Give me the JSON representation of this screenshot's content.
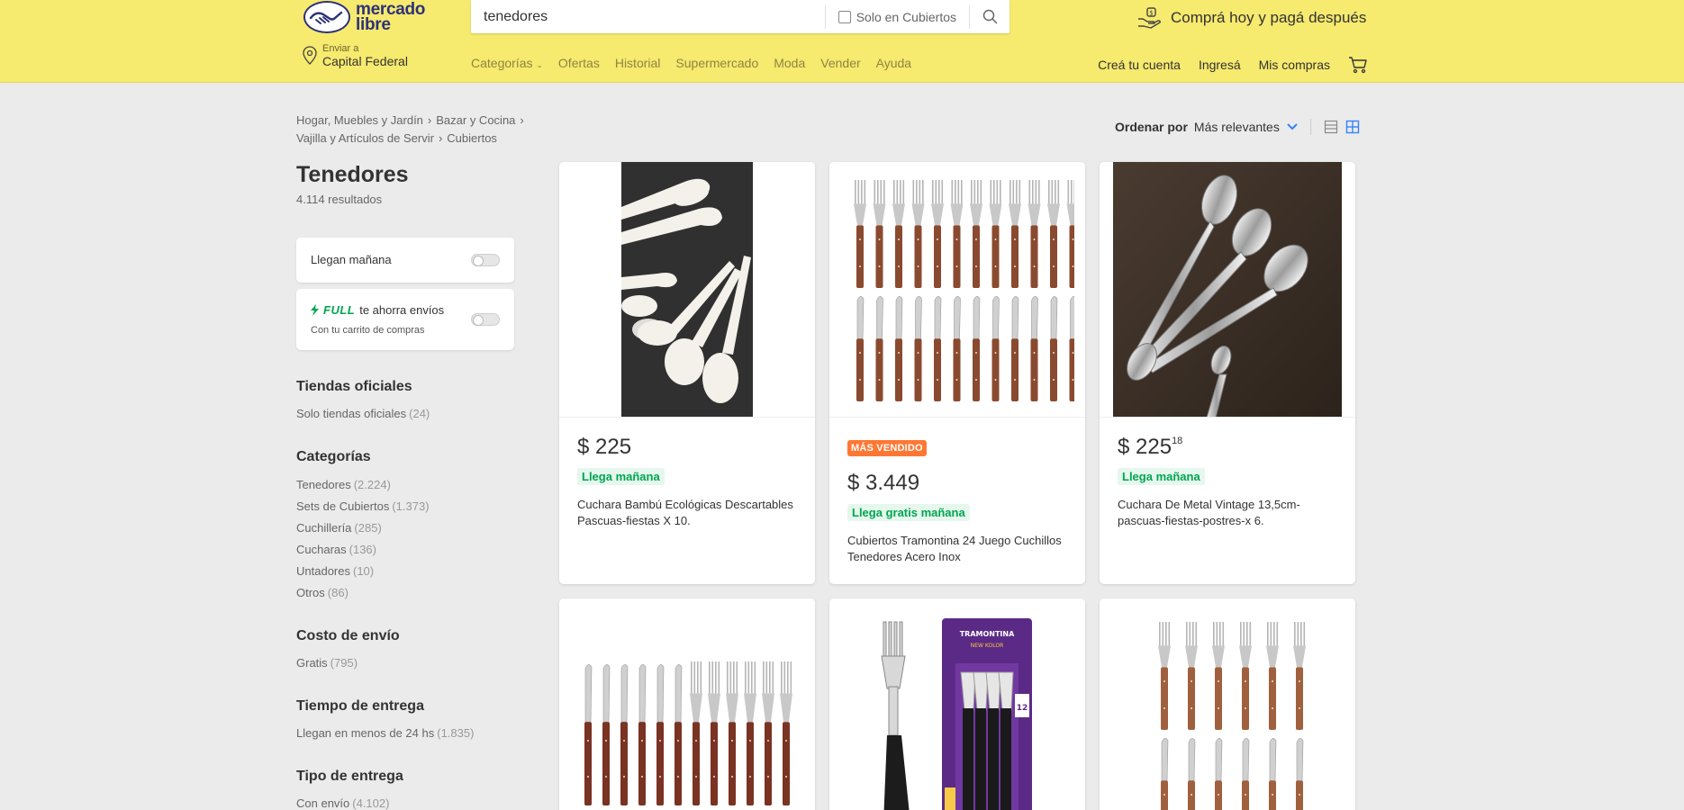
{
  "header": {
    "logo_line1": "mercado",
    "logo_line2": "libre",
    "search_value": "tenedores",
    "search_filter_label": "Solo en Cubiertos",
    "promo_text": "Comprá hoy y pagá después",
    "location_label": "Enviar a",
    "location_value": "Capital Federal",
    "nav": [
      "Categorías",
      "Ofertas",
      "Historial",
      "Supermercado",
      "Moda",
      "Vender",
      "Ayuda"
    ],
    "user_nav": [
      "Creá tu cuenta",
      "Ingresá",
      "Mis compras"
    ]
  },
  "breadcrumb": [
    "Hogar, Muebles y Jardín",
    "Bazar y Cocina",
    "Vajilla y Artículos de Servir",
    "Cubiertos"
  ],
  "page": {
    "title": "Tenedores",
    "results": "4.114 resultados"
  },
  "filters": {
    "llegan_manana": "Llegan mañana",
    "full_brand": "FULL",
    "full_text": "te ahorra envíos",
    "full_sub": "Con tu carrito de compras"
  },
  "sections": {
    "tiendas": {
      "title": "Tiendas oficiales",
      "items": [
        {
          "label": "Solo tiendas oficiales",
          "qty": "(24)"
        }
      ]
    },
    "categorias": {
      "title": "Categorías",
      "items": [
        {
          "label": "Tenedores",
          "qty": "(2.224)"
        },
        {
          "label": "Sets de Cubiertos",
          "qty": "(1.373)"
        },
        {
          "label": "Cuchillería",
          "qty": "(285)"
        },
        {
          "label": "Cucharas",
          "qty": "(136)"
        },
        {
          "label": "Untadores",
          "qty": "(10)"
        },
        {
          "label": "Otros",
          "qty": "(86)"
        }
      ]
    },
    "costo": {
      "title": "Costo de envío",
      "items": [
        {
          "label": "Gratis",
          "qty": "(795)"
        }
      ]
    },
    "tiempo": {
      "title": "Tiempo de entrega",
      "items": [
        {
          "label": "Llegan en menos de 24 hs",
          "qty": "(1.835)"
        }
      ]
    },
    "tipo": {
      "title": "Tipo de entrega",
      "items": [
        {
          "label": "Con envío",
          "qty": "(4.102)"
        }
      ]
    }
  },
  "sort": {
    "label": "Ordenar por",
    "value": "Más relevantes"
  },
  "products": [
    {
      "price": "$ 225",
      "cents": "",
      "badge": "",
      "shipping": "Llega mañana",
      "title": "Cuchara Bambú Ecológicas Descartables Pascuas-fiestas X 10."
    },
    {
      "price": "$ 3.449",
      "cents": "",
      "badge": "MÁS VENDIDO",
      "shipping": "Llega gratis mañana",
      "title": "Cubiertos Tramontina 24 Juego Cuchillos Tenedores Acero Inox"
    },
    {
      "price": "$ 225",
      "cents": "18",
      "badge": "",
      "shipping": "Llega mañana",
      "title": "Cuchara De Metal Vintage 13,5cm-pascuas-fiestas-postres-x 6."
    }
  ],
  "package_text": [
    "TRAMONTINA",
    "NEW KOLOR",
    "12"
  ],
  "colors": {
    "header_bg": "#f6ea6f",
    "brand_blue": "#2d3277",
    "link_blue": "#3483fa",
    "green": "#00a650",
    "orange": "#ff7733"
  }
}
